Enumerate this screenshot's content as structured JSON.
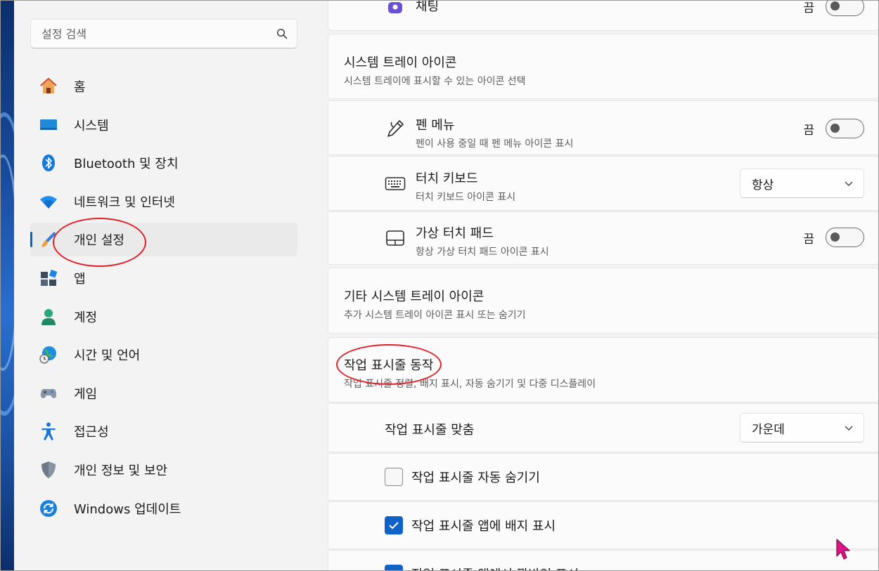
{
  "sidebar": {
    "search": {
      "placeholder": "설정 검색"
    },
    "items": [
      {
        "label": "홈",
        "icon": "home-icon"
      },
      {
        "label": "시스템",
        "icon": "system-icon"
      },
      {
        "label": "Bluetooth 및 장치",
        "icon": "bluetooth-icon"
      },
      {
        "label": "네트워크 및 인터넷",
        "icon": "wifi-icon"
      },
      {
        "label": "개인 설정",
        "icon": "brush-icon",
        "active": true
      },
      {
        "label": "앱",
        "icon": "apps-icon"
      },
      {
        "label": "계정",
        "icon": "account-icon"
      },
      {
        "label": "시간 및 언어",
        "icon": "globe-clock-icon"
      },
      {
        "label": "게임",
        "icon": "gamepad-icon"
      },
      {
        "label": "접근성",
        "icon": "accessibility-icon"
      },
      {
        "label": "개인 정보 및 보안",
        "icon": "shield-icon"
      },
      {
        "label": "Windows 업데이트",
        "icon": "update-icon"
      }
    ]
  },
  "main": {
    "top_partial": {
      "label": "채팅",
      "state": "끔"
    },
    "tray_section": {
      "title": "시스템 트레이 아이콘",
      "subtitle": "시스템 트레이에 표시할 수 있는 아이콘 선택",
      "rows": [
        {
          "title": "펜 메뉴",
          "subtitle": "펜이 사용 중일 때 펜 메뉴 아이콘 표시",
          "control": "toggle",
          "state": "끔"
        },
        {
          "title": "터치 키보드",
          "subtitle": "터치 키보드 아이콘 표시",
          "control": "dropdown",
          "value": "항상"
        },
        {
          "title": "가상 터치 패드",
          "subtitle": "항상 가상 터치 패드 아이콘 표시",
          "control": "toggle",
          "state": "끔"
        }
      ]
    },
    "other_tray": {
      "title": "기타 시스템 트레이 아이콘",
      "subtitle": "추가 시스템 트레이 아이콘 표시 또는 숨기기"
    },
    "behaviors": {
      "title": "작업 표시줄 동작",
      "subtitle": "작업 표시줄 정렬, 배지 표시, 자동 숨기기 및 다중 디스플레이",
      "alignment_label": "작업 표시줄 맞춤",
      "alignment_value": "가운데",
      "autohide_label": "작업 표시줄 자동 숨기기",
      "autohide_checked": false,
      "badges_label": "작업 표시줄 앱에 배지 표시",
      "badges_checked": true,
      "partial_label": "작업 표시줄 앱에서 깜박임 표시"
    }
  },
  "colors": {
    "accent": "#0067c0",
    "annotation": "#e0202a",
    "cursor": "#e0158a"
  }
}
